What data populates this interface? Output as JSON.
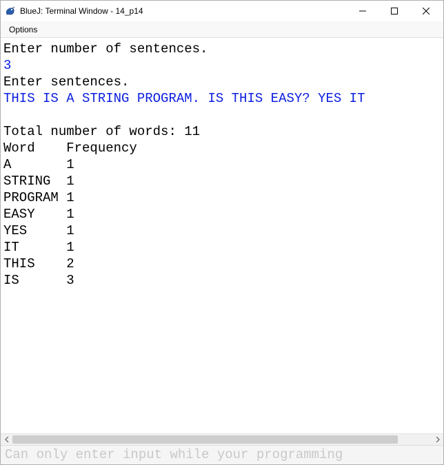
{
  "window": {
    "title": "BlueJ: Terminal Window - 14_p14"
  },
  "menubar": {
    "options": "Options"
  },
  "terminal": {
    "prompt1": "Enter number of sentences.",
    "input1": "3",
    "prompt2": "Enter sentences.",
    "input2": "THIS IS A STRING PROGRAM. IS THIS EASY? YES IT",
    "totalLine": "Total number of words: 11",
    "headerLine": "Word    Frequency",
    "rows": [
      "A       1",
      "STRING  1",
      "PROGRAM 1",
      "EASY    1",
      "YES     1",
      "IT      1",
      "THIS    2",
      "IS      3"
    ]
  },
  "inputArea": {
    "placeholder": "Can only enter input while your programming"
  }
}
